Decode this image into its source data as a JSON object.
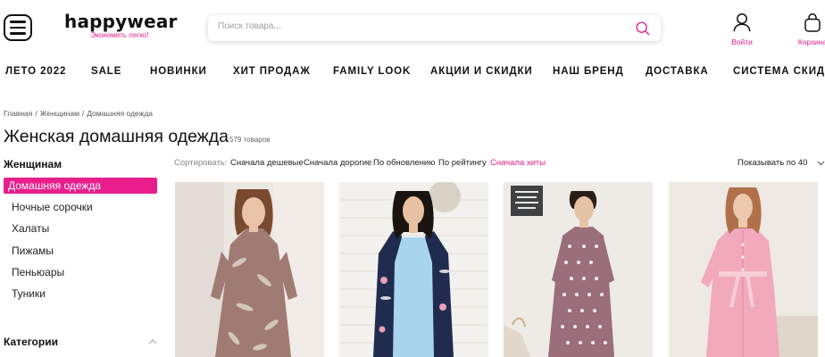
{
  "header": {
    "logo_text": "happywear",
    "logo_tagline": "Экономить легко!",
    "search_placeholder": "Поиск товара...",
    "login_label": "Войти",
    "cart_label": "Корзина"
  },
  "nav": {
    "items": [
      "ЛЕТО 2022",
      "SALE",
      "НОВИНКИ",
      "ХИТ ПРОДАЖ",
      "FAMILY LOOK",
      "АКЦИИ И СКИДКИ",
      "НАШ БРЕНД",
      "ДОСТАВКА",
      "СИСТЕМА СКИДОК"
    ]
  },
  "breadcrumb": [
    "Главная",
    "Женщинам",
    "Домашняя одежда"
  ],
  "page": {
    "title": "Женская домашняя одежда",
    "count": "579 товаров"
  },
  "sidebar": {
    "heading": "Женщинам",
    "items": [
      "Домашняя одежда",
      "Ночные сорочки",
      "Халаты",
      "Пижамы",
      "Пеньюары",
      "Туники"
    ],
    "active_index": 0,
    "categories_heading": "Категории"
  },
  "sort": {
    "label": "Сортировать:",
    "options": [
      "Сначала дешевые",
      "Сначала дорогие",
      "По обновлению",
      "По рейтингу",
      "Сначала хиты"
    ],
    "active_index": 4,
    "per_page": "Показывать по 40"
  },
  "products": [
    {
      "photo": "woman-in-mauve-leaf-print-dress",
      "garment_color": "#a07b74"
    },
    {
      "photo": "woman-in-light-blue-nightgown-with-floral-robe",
      "garment_color": "#a9d4ee"
    },
    {
      "photo": "woman-in-mauve-polka-dot-dress",
      "garment_color": "#9a6e7a"
    },
    {
      "photo": "pregnant-woman-in-pink-robe",
      "garment_color": "#f2a9bb"
    }
  ],
  "colors": {
    "accent": "#e91e8c",
    "text": "#111111",
    "muted": "#888888"
  }
}
